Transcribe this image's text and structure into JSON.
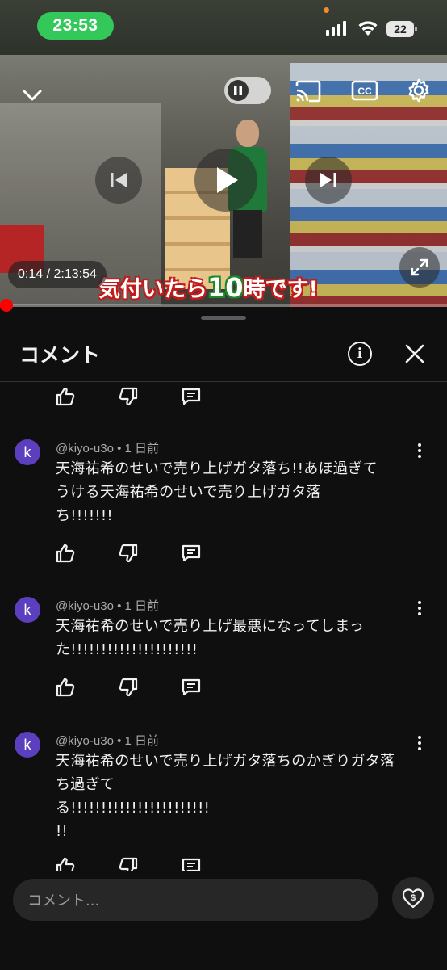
{
  "status_bar": {
    "time": "23:53",
    "battery": "22"
  },
  "video": {
    "time_display": "0:14 / 2:13:54",
    "progress_fraction": 0.0017,
    "caption_part1": "気付いたら",
    "caption_big": "10",
    "caption_part2": "時です!"
  },
  "panel": {
    "title": "コメント"
  },
  "comments": [
    {
      "avatar_letter": "k",
      "meta": "@kiyo-u3o • 1 日前",
      "lines": [
        "天海祐希のせいで売り上げガタ落ち!!あほ過ぎて",
        "うける天海祐希のせいで売り上げガタ落",
        "ち!!!!!!!"
      ]
    },
    {
      "avatar_letter": "k",
      "meta": "@kiyo-u3o • 1 日前",
      "lines": [
        "天海祐希のせいで売り上げ最悪になってしまっ",
        "た!!!!!!!!!!!!!!!!!!!!!"
      ]
    },
    {
      "avatar_letter": "k",
      "meta": "@kiyo-u3o • 1 日前",
      "lines": [
        "天海祐希のせいで売り上げガタ落ちのかぎりガタ落",
        "ち過ぎて",
        "る!!!!!!!!!!!!!!!!!!!!!!!",
        "!!"
      ]
    }
  ],
  "input": {
    "placeholder": "コメント..."
  },
  "icons": {
    "like": "thumbs-up-icon",
    "dislike": "thumbs-down-icon",
    "reply": "reply-icon",
    "more": "more-vert-icon",
    "thanks": "super-thanks-icon"
  },
  "colors": {
    "accent": "#ff0000",
    "status_pill": "#34c759",
    "avatar": "#5b3fbf"
  }
}
